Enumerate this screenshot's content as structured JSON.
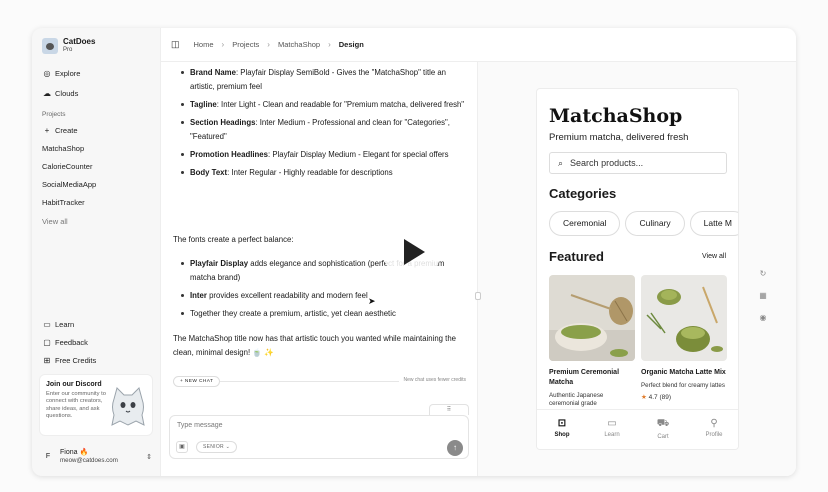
{
  "brand": {
    "name": "CatDoes",
    "plan": "Pro"
  },
  "sidebar": {
    "nav": [
      {
        "label": "Explore",
        "icon": "compass-icon"
      },
      {
        "label": "Clouds",
        "icon": "cloud-icon"
      }
    ],
    "projects_label": "Projects",
    "create_label": "Create",
    "projects": [
      "MatchaShop",
      "CalorieCounter",
      "SocialMediaApp",
      "HabitTracker"
    ],
    "view_all": "View all",
    "bottom": [
      {
        "label": "Learn",
        "icon": "book-icon"
      },
      {
        "label": "Feedback",
        "icon": "message-icon"
      },
      {
        "label": "Free Credits",
        "icon": "gift-icon"
      }
    ],
    "discord": {
      "title": "Join our Discord",
      "text": "Enter our community to connect with creators, share ideas, and ask questions."
    },
    "user": {
      "initial": "F",
      "name": "Fiona 🔥",
      "email": "meow@catdoes.com"
    }
  },
  "breadcrumb": [
    "Home",
    "Projects",
    "MatchaShop",
    "Design"
  ],
  "chat": {
    "fonts_list": [
      {
        "name": "Brand Name",
        "desc": ": Playfair Display SemiBold - Gives the \"MatchaShop\" title an artistic, premium feel"
      },
      {
        "name": "Tagline",
        "desc": ": Inter Light - Clean and readable for \"Premium matcha, delivered fresh\""
      },
      {
        "name": "Section Headings",
        "desc": ": Inter Medium - Professional and clean for \"Categories\", \"Featured\""
      },
      {
        "name": "Promotion Headlines",
        "desc": ": Playfair Display Medium - Elegant for special offers"
      },
      {
        "name": "Body Text",
        "desc": ": Inter Regular - Highly readable for descriptions"
      }
    ],
    "balance_intro": "The fonts create a perfect balance:",
    "balance_list": [
      {
        "name": "Playfair Display",
        "desc": " adds elegance and sophistication (perfect for a premium matcha brand)"
      },
      {
        "name": "Inter",
        "desc": " provides excellent readability and modern feel"
      },
      {
        "name": "",
        "desc": "Together they create a premium, artistic, yet clean aesthetic"
      }
    ],
    "closing": "The MatchaShop title now has that artistic touch you wanted while maintaining the clean, minimal design! 🍵 ✨",
    "new_chat_label": "+ NEW CHAT",
    "new_chat_note": "New chat uses fewer credits",
    "input_placeholder": "Type message",
    "model_label": "SENIOR",
    "drag_label": "⠿"
  },
  "preview": {
    "title": "MatchaShop",
    "subtitle": "Premium matcha, delivered fresh",
    "search_placeholder": "Search products...",
    "categories_heading": "Categories",
    "categories": [
      "Ceremonial",
      "Culinary",
      "Latte M"
    ],
    "featured_heading": "Featured",
    "view_all": "View all",
    "products": [
      {
        "name": "Premium Ceremonial Matcha",
        "desc": "Authentic Japanese ceremonial grade",
        "rating": ""
      },
      {
        "name": "Organic Matcha Latte Mix",
        "desc": "Perfect blend for creamy lattes",
        "rating": "4.7 (89)"
      }
    ],
    "tabs": [
      {
        "label": "Shop",
        "icon": "bag-icon"
      },
      {
        "label": "Learn",
        "icon": "book-icon"
      },
      {
        "label": "Cart",
        "icon": "cart-icon"
      },
      {
        "label": "Profile",
        "icon": "user-icon"
      }
    ],
    "accent": "#e07b2a"
  }
}
